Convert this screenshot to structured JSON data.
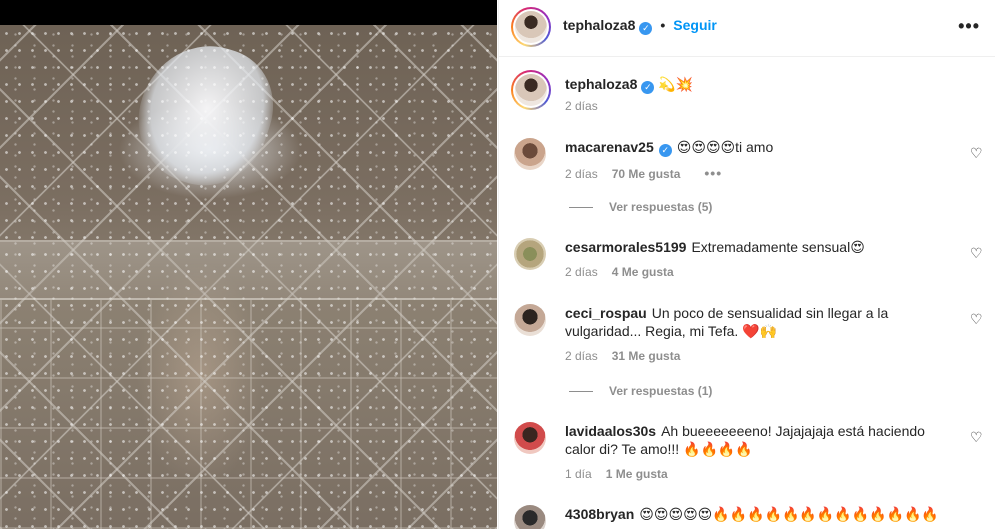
{
  "post": {
    "author": "tephaloza8",
    "follow_label": "Seguir",
    "dot": "•",
    "more": "•••",
    "caption_text": "💫💥",
    "caption_time": "2 días"
  },
  "comments": [
    {
      "username": "macarenav25",
      "verified": true,
      "text": "😍😍😍😍ti amo",
      "time": "2 días",
      "likes": "70 Me gusta",
      "more": "•••",
      "replies": "Ver respuestas (5)"
    },
    {
      "username": "cesarmorales5199",
      "text": "Extremadamente sensual😍",
      "time": "2 días",
      "likes": "4 Me gusta"
    },
    {
      "username": "ceci_rospau",
      "text": "Un poco de sensualidad sin llegar a la vulgaridad... Regia, mi Tefa. ❤️🙌",
      "time": "2 días",
      "likes": "31 Me gusta",
      "replies": "Ver respuestas (1)"
    },
    {
      "username": "lavidaalos30s",
      "text": "Ah bueeeeeeeno! Jajajajaja está haciendo calor di? Te amo!!! 🔥🔥🔥🔥",
      "time": "1 día",
      "likes": "1 Me gusta"
    },
    {
      "username": "4308bryan",
      "text": "😍😍😍😍😍🔥🔥🔥🔥🔥🔥🔥🔥🔥🔥🔥🔥🔥"
    }
  ],
  "icons": {
    "heart": "♡",
    "verified": "✓"
  },
  "colors": {
    "accent": "#0095f6",
    "verified": "#3897f0",
    "muted": "#8e8e8e",
    "text": "#262626"
  }
}
